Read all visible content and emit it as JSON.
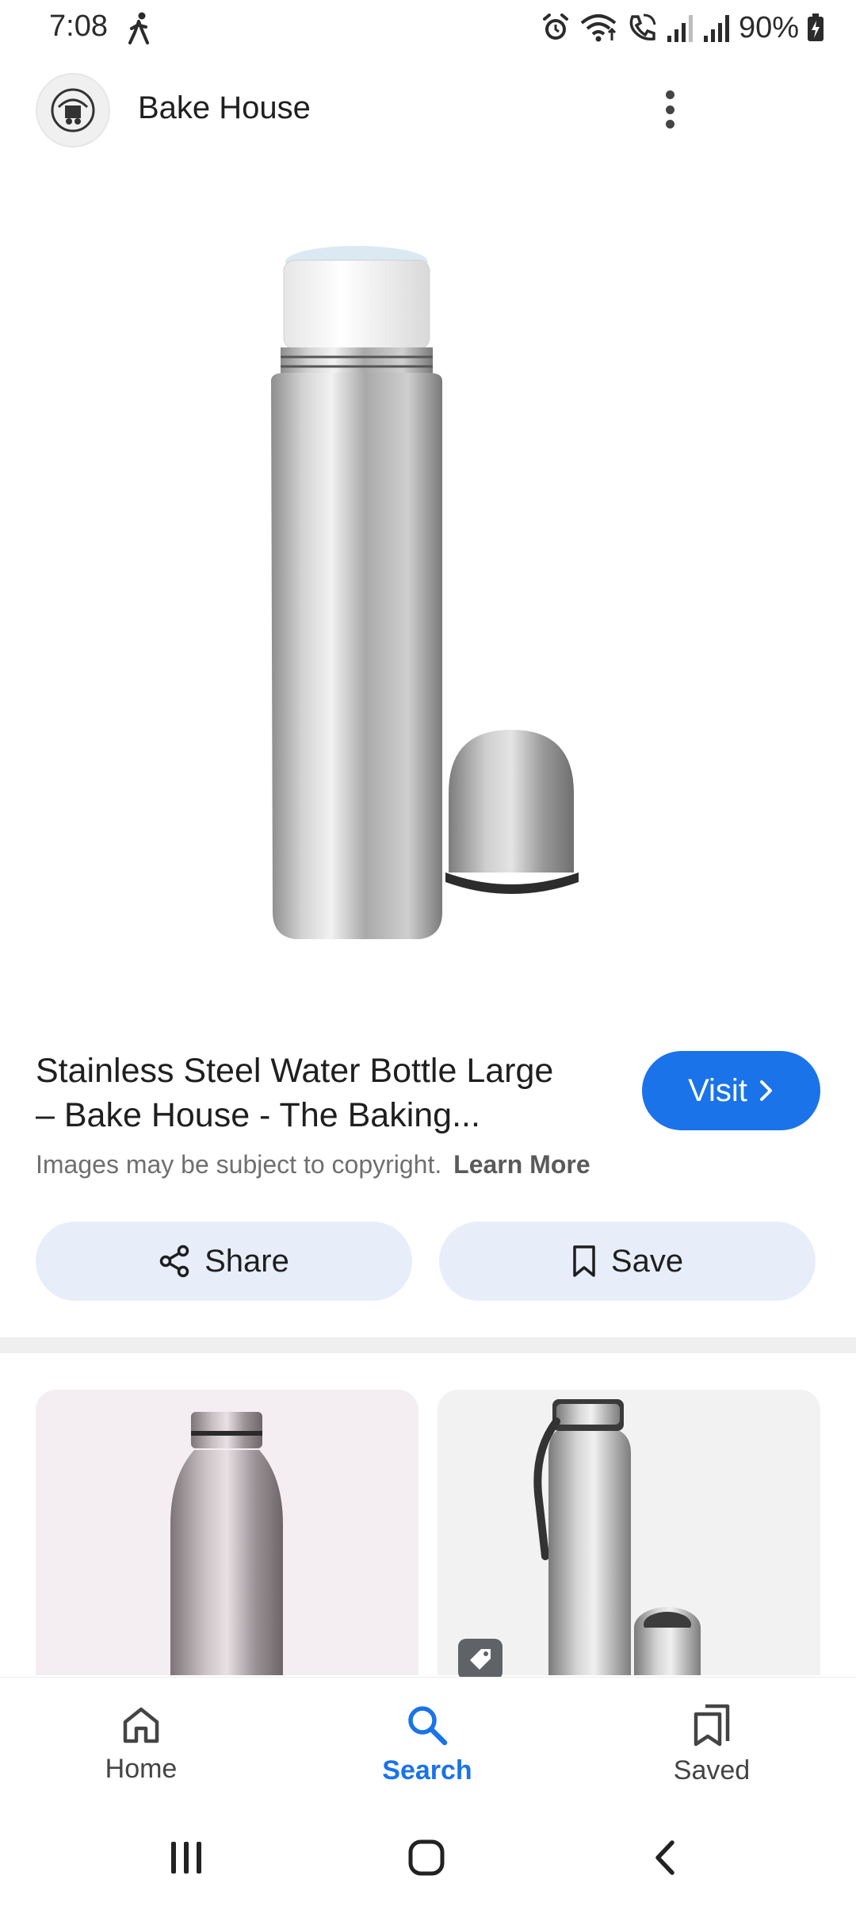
{
  "status_bar": {
    "time": "7:08",
    "battery": "90%",
    "icons": [
      "walking-icon",
      "alarm-icon",
      "wifi-icon",
      "wifi-call-icon",
      "signal-icon",
      "signal-icon",
      "battery-charging-icon"
    ]
  },
  "header": {
    "site_name": "Bake House",
    "avatar_icon": "site-logo",
    "menu_icon": "more-vert-icon"
  },
  "result": {
    "title_line1": "Stainless Steel Water Bottle Large",
    "title_line2": "– Bake House - The Baking...",
    "visit_label": "Visit",
    "copyright_text": "Images may be subject to copyright.",
    "learn_more": "Learn More",
    "share_label": "Share",
    "save_label": "Save"
  },
  "bottom_nav": {
    "items": [
      {
        "label": "Home",
        "icon": "home-icon"
      },
      {
        "label": "Search",
        "icon": "search-icon",
        "active": true
      },
      {
        "label": "Saved",
        "icon": "saved-icon"
      }
    ]
  },
  "system_nav": {
    "icons": [
      "recents-icon",
      "home-circle-icon",
      "back-icon"
    ]
  },
  "colors": {
    "accent": "#1a73e8",
    "chip_background": "#e8eef9",
    "divider": "#efefef"
  }
}
